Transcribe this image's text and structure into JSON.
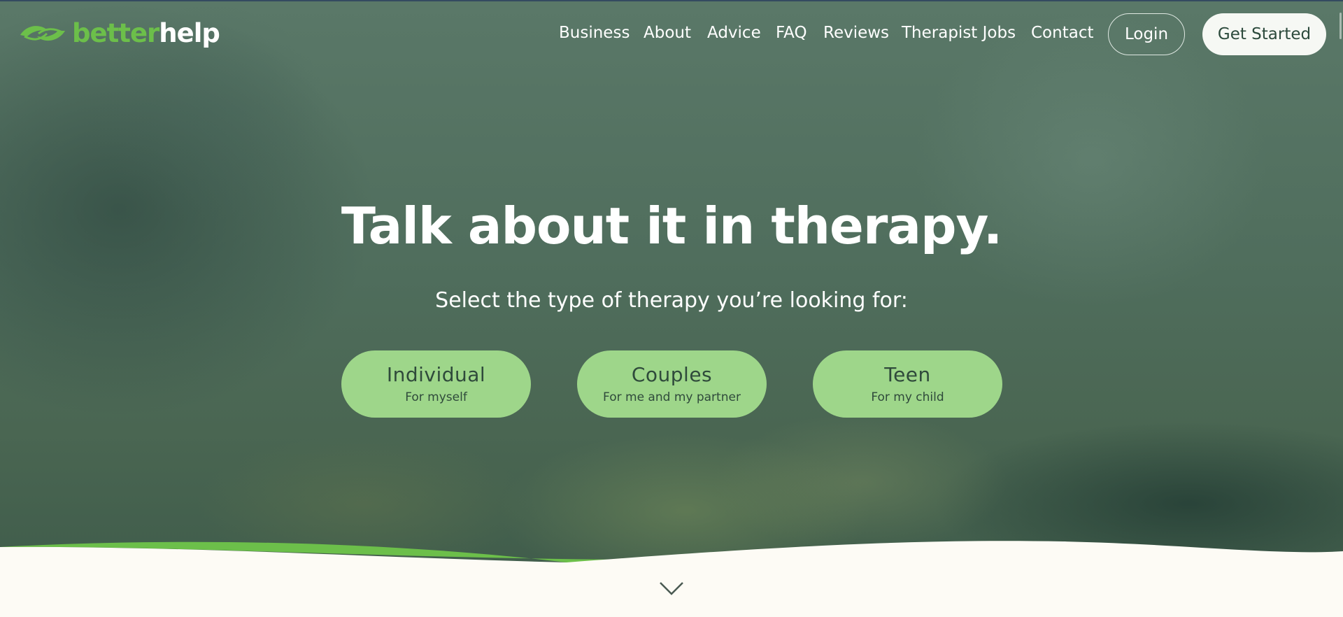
{
  "logo": {
    "part1": "better",
    "part2": "help"
  },
  "nav": {
    "items": [
      "Business",
      "About",
      "Advice",
      "FAQ",
      "Reviews",
      "Therapist Jobs",
      "Contact"
    ],
    "login_label": "Login",
    "get_started_label": "Get Started"
  },
  "hero": {
    "headline": "Talk about it in therapy.",
    "subhead": "Select the type of therapy you’re looking for:",
    "options": [
      {
        "title": "Individual",
        "subtitle": "For myself"
      },
      {
        "title": "Couples",
        "subtitle": "For me and my partner"
      },
      {
        "title": "Teen",
        "subtitle": "For my child"
      }
    ]
  },
  "icons": {
    "logo": "leaf-hands-logo-icon",
    "scroll": "chevron-down-icon"
  },
  "colors": {
    "brand_green": "#6cbf4a",
    "button_green": "#9ed68a",
    "hero_overlay": "#4f6d5c",
    "footer_bg": "#fdfbf5",
    "button_text": "#2f4a3b"
  }
}
